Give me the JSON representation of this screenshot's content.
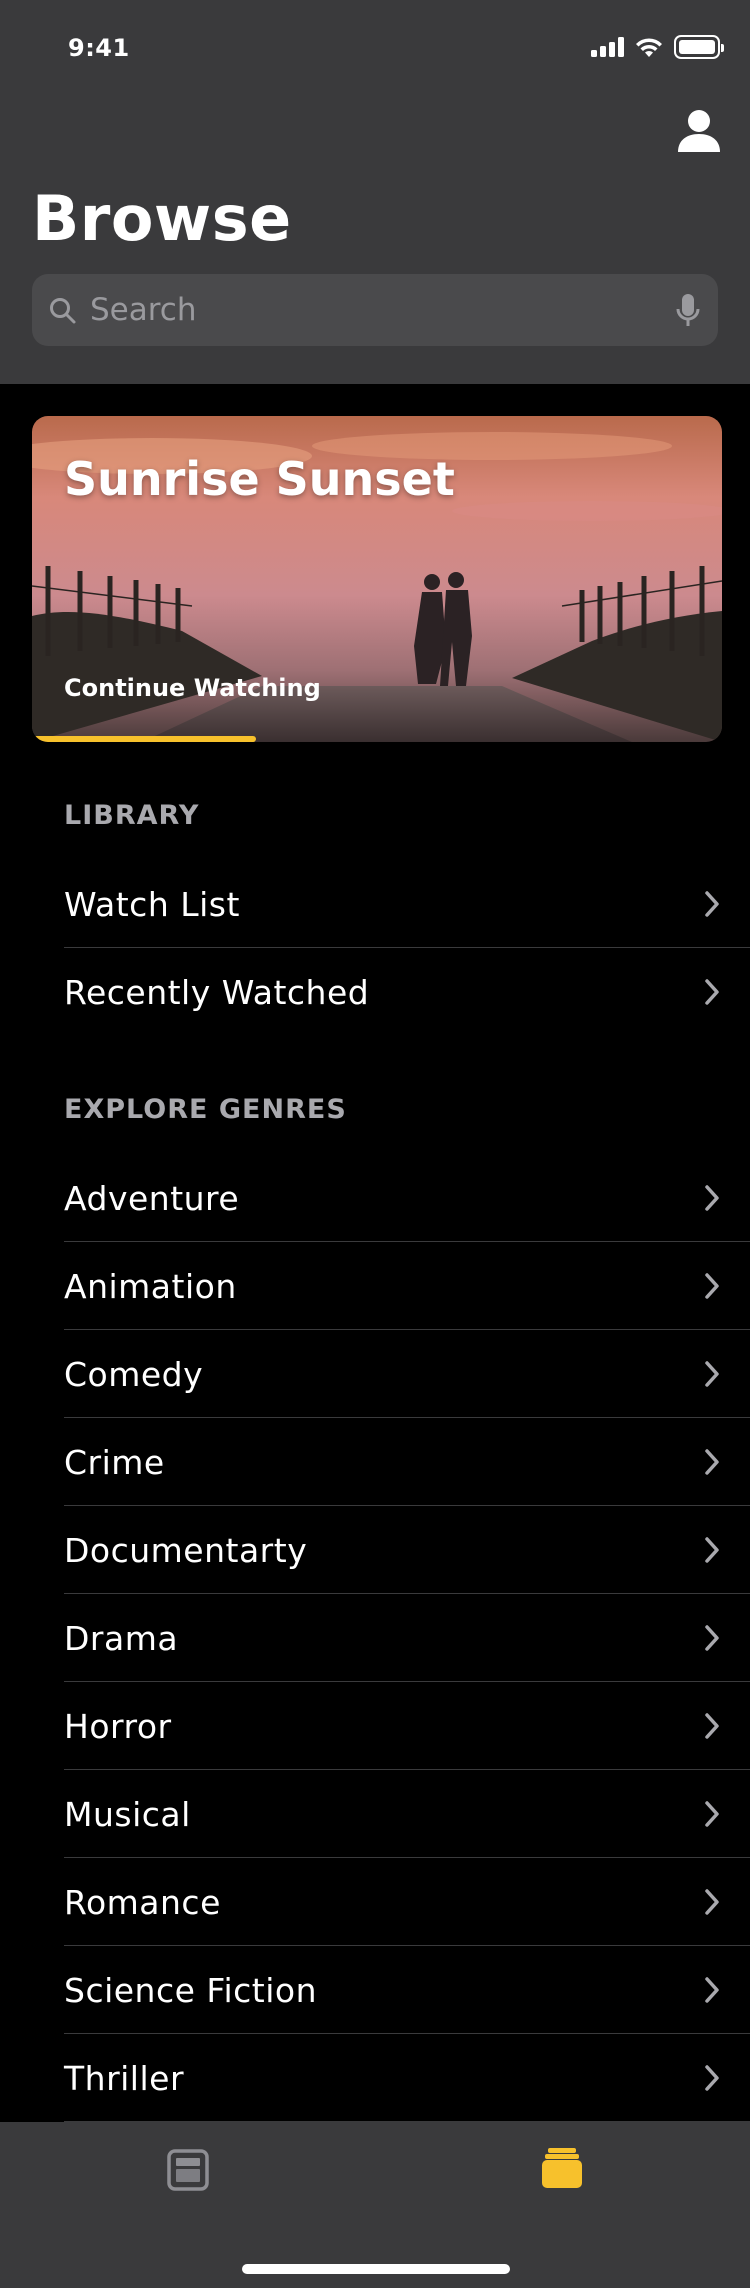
{
  "status_bar": {
    "time": "9:41"
  },
  "header": {
    "title": "Browse",
    "search": {
      "placeholder": "Search",
      "value": ""
    }
  },
  "feature": {
    "title": "Sunrise Sunset",
    "subtitle": "Continue Watching",
    "progress": 0.325,
    "accent_color": "#f7c12c"
  },
  "library": {
    "header": "LIBRARY",
    "items": [
      {
        "label": "Watch List"
      },
      {
        "label": "Recently Watched"
      }
    ]
  },
  "genres": {
    "header": "EXPLORE GENRES",
    "items": [
      {
        "label": "Adventure"
      },
      {
        "label": "Animation"
      },
      {
        "label": "Comedy"
      },
      {
        "label": "Crime"
      },
      {
        "label": "Documentarty"
      },
      {
        "label": "Drama"
      },
      {
        "label": "Horror"
      },
      {
        "label": "Musical"
      },
      {
        "label": "Romance"
      },
      {
        "label": "Science Fiction"
      },
      {
        "label": "Thriller"
      }
    ]
  },
  "tabbar": {
    "tabs": [
      {
        "icon": "browse-icon",
        "selected": false
      },
      {
        "icon": "library-stack-icon",
        "selected": true
      }
    ]
  },
  "colors": {
    "header_bg": "#3a3a3c",
    "background": "#000000",
    "accent": "#f7c12c",
    "section_header": "#a9a9ae"
  }
}
